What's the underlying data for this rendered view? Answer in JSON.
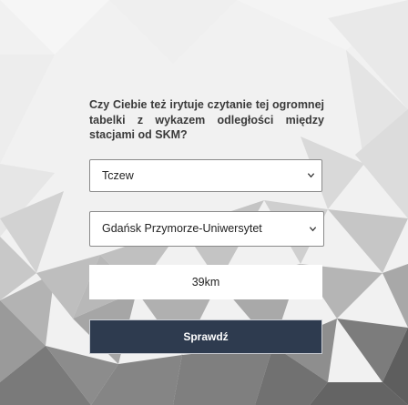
{
  "intro": {
    "text": "Czy Ciebie też irytuje czytanie tej ogromnej tabelki z wykazem odległości między stacjami od SKM?"
  },
  "form": {
    "from_station": {
      "value": "Tczew",
      "icon": "chevron-down-icon"
    },
    "to_station": {
      "value": "Gdańsk Przymorze-Uniwersytet",
      "icon": "chevron-down-icon"
    },
    "result": "39km",
    "submit_label": "Sprawdź"
  },
  "colors": {
    "button_bg": "#2e3b4f",
    "page_light": "#f2f2f2",
    "page_dark": "#5a5a5a"
  }
}
